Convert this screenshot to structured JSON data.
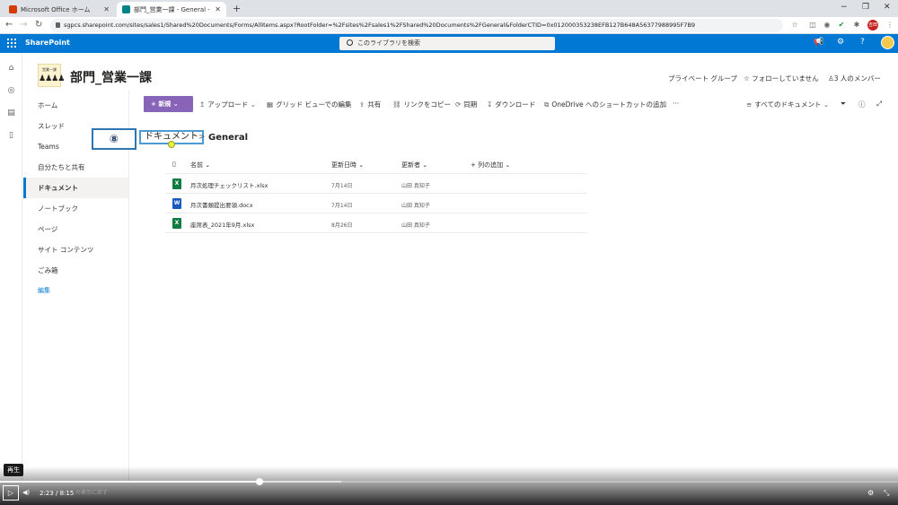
{
  "browser": {
    "tabs": [
      {
        "title": "Microsoft Office ホーム",
        "favicon_color": "#d83b01"
      },
      {
        "title": "部門_営業一課 - General - すべての",
        "favicon_color": "#038387"
      }
    ],
    "new_tab": "+",
    "url": "sgpcs.sharepoint.com/sites/sales1/Shared%20Documents/Forms/AllItems.aspx?RootFolder=%2Fsites%2Fsales1%2FShared%20Documents%2FGeneral&FolderCTID=0x012000353238EFB127B648A56377988995F7B9",
    "profile_initials": "吉田",
    "window_controls": {
      "minimize": "−",
      "restore": "❐",
      "close": "✕"
    },
    "nav": {
      "back": "←",
      "forward": "→",
      "reload": "↻"
    }
  },
  "suite": {
    "brand": "SharePoint",
    "search_placeholder": "このライブラリを検索",
    "accent": "#0078d4"
  },
  "site": {
    "logo_text": "営業一課",
    "logo_people": "♟♟♟♟",
    "title": "部門_営業一課",
    "privacy": "プライベート グループ",
    "follow": "フォローしていません",
    "members": "3 人のメンバー"
  },
  "leftnav": {
    "items": [
      {
        "label": "ホーム"
      },
      {
        "label": "スレッド"
      },
      {
        "label": "Teams"
      },
      {
        "label": "自分たちと共有"
      },
      {
        "label": "ドキュメント"
      },
      {
        "label": "ノートブック"
      },
      {
        "label": "ページ"
      },
      {
        "label": "サイト コンテンツ"
      },
      {
        "label": "ごみ箱"
      },
      {
        "label": "編集"
      }
    ],
    "selected": "ドキュメント"
  },
  "commandbar": {
    "new": "新規",
    "upload": "アップロード",
    "grid_edit": "グリッド ビューでの編集",
    "share": "共有",
    "copy_link": "リンクをコピー",
    "sync": "同期",
    "download": "ダウンロード",
    "onedrive_shortcut": "OneDrive へのショートカットの追加",
    "more": "···",
    "view": "すべてのドキュメント",
    "brand_color": "#8764b8"
  },
  "breadcrumb": {
    "root": "ドキュメント",
    "separator": ">",
    "current": "General"
  },
  "annotation": {
    "step": "⑧"
  },
  "list": {
    "columns": {
      "name": "名前",
      "modified": "更新日時",
      "modified_by": "更新者",
      "add_column": "列の追加"
    },
    "rows": [
      {
        "name": "月次処理チェックリスト.xlsx",
        "modified": "7月14日",
        "modified_by": "山田 真知子",
        "type": "xlsx"
      },
      {
        "name": "月次書類提出要領.docx",
        "modified": "7月14日",
        "modified_by": "山田 真知子",
        "type": "docx"
      },
      {
        "name": "座席表_2021年9月.xlsx",
        "modified": "8月26日",
        "modified_by": "山田 真知子",
        "type": "xlsx"
      }
    ]
  },
  "video": {
    "tooltip": "再生",
    "current_time": "2:23",
    "separator": "/",
    "duration": "8:15",
    "progress_fraction": 0.289,
    "buffered_fraction": 0.38,
    "subtitle_hint": "の表示に戻す"
  }
}
